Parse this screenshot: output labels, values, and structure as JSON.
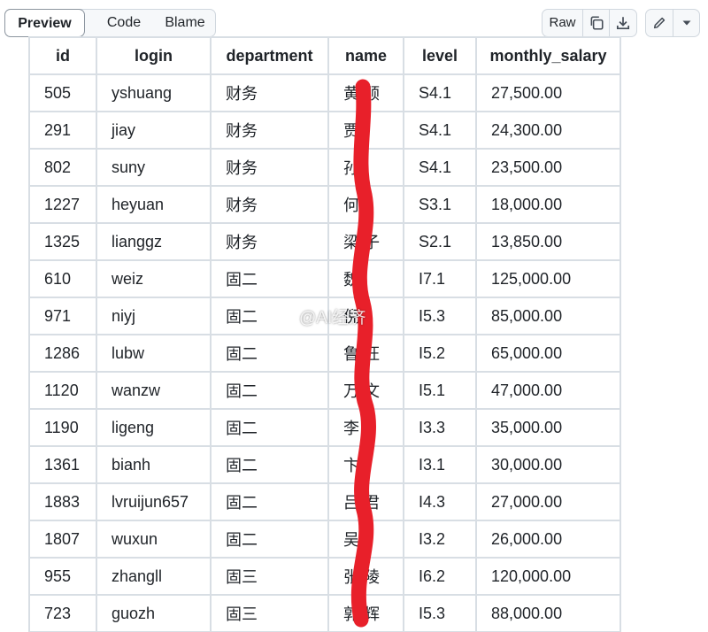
{
  "view_tabs": [
    {
      "label": "Preview",
      "active": true
    },
    {
      "label": "Code",
      "active": false
    },
    {
      "label": "Blame",
      "active": false
    }
  ],
  "file_actions": {
    "raw_label": "Raw",
    "copy_icon": "copy-icon",
    "download_icon": "download-icon",
    "edit_icon": "pencil-icon",
    "more_icon": "triangle-down-icon"
  },
  "table": {
    "columns": [
      "id",
      "login",
      "department",
      "name",
      "level",
      "monthly_salary"
    ],
    "rows": [
      [
        "505",
        "yshuang",
        "财务",
        "黄   顺",
        "S4.1",
        "27,500.00"
      ],
      [
        "291",
        "jiay",
        "财务",
        "贾",
        "S4.1",
        "24,300.00"
      ],
      [
        "802",
        "suny",
        "财务",
        "孙",
        "S4.1",
        "23,500.00"
      ],
      [
        "1227",
        "heyuan",
        "财务",
        "何",
        "S3.1",
        "18,000.00"
      ],
      [
        "1325",
        "lianggz",
        "财务",
        "梁   子",
        "S2.1",
        "13,850.00"
      ],
      [
        "610",
        "weiz",
        "固二",
        "魏",
        "I7.1",
        "125,000.00"
      ],
      [
        "971",
        "niyj",
        "固二",
        "倪",
        "I5.3",
        "85,000.00"
      ],
      [
        "1286",
        "lubw",
        "固二",
        "鲁   旺",
        "I5.2",
        "65,000.00"
      ],
      [
        "1120",
        "wanzw",
        "固二",
        "万   文",
        "I5.1",
        "47,000.00"
      ],
      [
        "1190",
        "ligeng",
        "固二",
        "李",
        "I3.3",
        "35,000.00"
      ],
      [
        "1361",
        "bianh",
        "固二",
        "卞",
        "I3.1",
        "30,000.00"
      ],
      [
        "1883",
        "lvruijun657",
        "固二",
        "吕   君",
        "I4.3",
        "27,000.00"
      ],
      [
        "1807",
        "wuxun",
        "固二",
        "吴",
        "I3.2",
        "26,000.00"
      ],
      [
        "955",
        "zhangll",
        "固三",
        "张   陵",
        "I6.2",
        "120,000.00"
      ],
      [
        "723",
        "guozh",
        "固三",
        "郭   辉",
        "I5.3",
        "88,000.00"
      ]
    ]
  },
  "watermark": "@AI经济",
  "colors": {
    "border": "#d8dee4",
    "redaction": "#e8202a",
    "button_bg": "#f6f8fa"
  }
}
